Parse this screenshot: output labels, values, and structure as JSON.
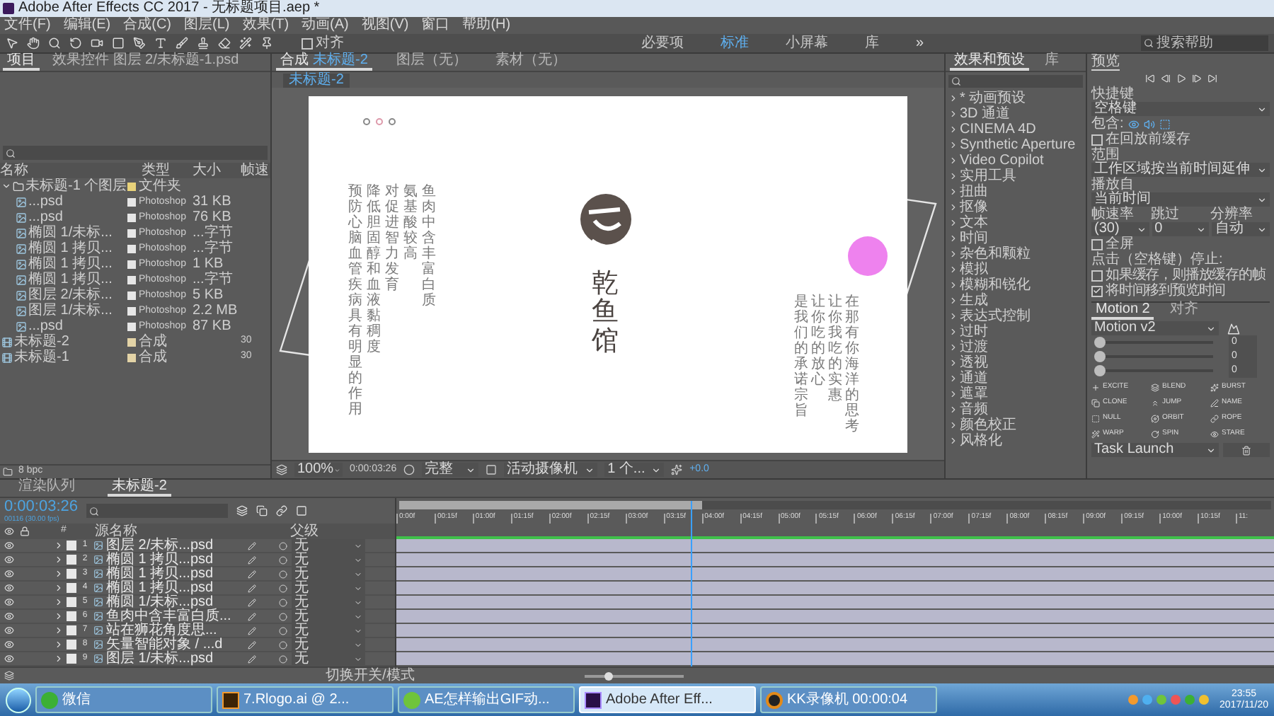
{
  "window": {
    "title": "Adobe After Effects CC 2017 - 无标题项目.aep *"
  },
  "menu": [
    "文件(F)",
    "编辑(E)",
    "合成(C)",
    "图层(L)",
    "效果(T)",
    "动画(A)",
    "视图(V)",
    "窗口",
    "帮助(H)"
  ],
  "toolbar": {
    "snap": {
      "label": "对齐",
      "checked": false
    },
    "workspaces": [
      {
        "label": "必要项",
        "selected": false
      },
      {
        "label": "标准",
        "selected": true
      },
      {
        "label": "小屏幕",
        "selected": false
      },
      {
        "label": "库",
        "selected": false
      }
    ],
    "overflow": "»",
    "search_placeholder": "搜索帮助"
  },
  "project": {
    "tabs": [
      {
        "label": "项目",
        "selected": true
      },
      {
        "label": "效果控件 图层 2/未标题-1.psd",
        "selected": false
      }
    ],
    "columns": [
      "名称",
      "类型",
      "大小",
      "帧速"
    ],
    "items": [
      {
        "kind": "folder",
        "name": "未标题-1 个图层",
        "type": "文件夹",
        "color": "#e8d27a",
        "expanded": true,
        "children": [
          {
            "kind": "psd",
            "name": "...psd",
            "type": "Photoshop",
            "size": "31 KB",
            "color": "#e6e6e6"
          },
          {
            "kind": "psd",
            "name": "...psd",
            "type": "Photoshop",
            "size": "76 KB",
            "color": "#e6e6e6"
          },
          {
            "kind": "psd",
            "name": "椭圆 1/未标...",
            "type": "Photoshop",
            "size": "...字节",
            "color": "#e6e6e6"
          },
          {
            "kind": "psd",
            "name": "椭圆 1 拷贝...",
            "type": "Photoshop",
            "size": "...字节",
            "color": "#e6e6e6"
          },
          {
            "kind": "psd",
            "name": "椭圆 1 拷贝...",
            "type": "Photoshop",
            "size": "1 KB",
            "color": "#e6e6e6"
          },
          {
            "kind": "psd",
            "name": "椭圆 1 拷贝...",
            "type": "Photoshop",
            "size": "...字节",
            "color": "#e6e6e6"
          },
          {
            "kind": "psd",
            "name": "图层 2/未标...",
            "type": "Photoshop",
            "size": "5 KB",
            "color": "#e6e6e6"
          },
          {
            "kind": "psd",
            "name": "图层 1/未标...",
            "type": "Photoshop",
            "size": "2.2 MB",
            "color": "#e6e6e6"
          },
          {
            "kind": "psd",
            "name": "...psd",
            "type": "Photoshop",
            "size": "87 KB",
            "color": "#e6e6e6"
          }
        ]
      },
      {
        "kind": "comp",
        "name": "未标题-2",
        "type": "合成",
        "fps": "30",
        "color": "#e3d3a6"
      },
      {
        "kind": "comp",
        "name": "未标题-1",
        "type": "合成",
        "fps": "30",
        "color": "#e3d3a6"
      }
    ],
    "footer": "8 bpc"
  },
  "viewer": {
    "tabs": [
      {
        "label": "合成",
        "name": "未标题-2",
        "selected": true
      },
      {
        "label": "图层（无）",
        "selected": false
      },
      {
        "label": "素材（无）",
        "selected": false
      }
    ],
    "breadcrumb": "未标题-2",
    "artboard": {
      "left_columns": [
        "预防心脑血管疾病具有明显的作用",
        "降低胆固醇和血液黏稠度",
        "对促进智力发育",
        "氨基酸较高",
        "鱼肉中含丰富白质"
      ],
      "logo_title": "乾鱼馆",
      "right_columns": [
        "是我们的承诺宗旨",
        "让你吃的放心",
        "让你我吃的实惠",
        "在那有你海洋的思考"
      ]
    },
    "controls": {
      "zoom": "100%",
      "time": "0:00:03:26",
      "resolution": "完整",
      "camera": "活动摄像机",
      "views": "1 个...",
      "exposure": "+0.0"
    }
  },
  "effects": {
    "tabs": [
      {
        "label": "效果和预设",
        "selected": true
      },
      {
        "label": "库",
        "selected": false
      }
    ],
    "items": [
      "* 动画预设",
      "3D 通道",
      "CINEMA 4D",
      "Synthetic Aperture",
      "Video Copilot",
      "实用工具",
      "扭曲",
      "抠像",
      "文本",
      "时间",
      "杂色和颗粒",
      "模拟",
      "模糊和锐化",
      "生成",
      "表达式控制",
      "过时",
      "过渡",
      "透视",
      "通道",
      "遮罩",
      "音频",
      "颜色校正",
      "风格化"
    ]
  },
  "preview": {
    "title": "预览",
    "shortcut_label": "快捷键",
    "shortcut": "空格键",
    "include_label": "包含:",
    "cache_before": {
      "label": "在回放前缓存",
      "checked": false
    },
    "range_label": "范围",
    "range": "工作区域按当前时间延伸",
    "play_from_label": "播放自",
    "play_from": "当前时间",
    "frame_rate_label": "帧速率",
    "skip_label": "跳过",
    "resolution_label": "分辨率",
    "frame_rate": "(30)",
    "skip": "0",
    "resolution": "自动",
    "fullscreen": {
      "label": "全屏",
      "checked": false
    },
    "stop_label": "点击（空格键）停止:",
    "stop_options": [
      {
        "label": "如果缓存，则播放缓存的帧",
        "checked": false
      },
      {
        "label": "将时间移到预览时间",
        "checked": true
      }
    ]
  },
  "motion": {
    "tabs": [
      {
        "label": "Motion 2",
        "selected": true
      },
      {
        "label": "对齐",
        "selected": false
      }
    ],
    "preset": "Motion v2",
    "sliders": [
      {
        "level": 0,
        "value": "0"
      },
      {
        "level": 0,
        "value": "0"
      },
      {
        "level": 0,
        "value": "0"
      }
    ],
    "buttons": [
      "EXCITE",
      "BLEND",
      "BURST",
      "CLONE",
      "JUMP",
      "NAME",
      "NULL",
      "ORBIT",
      "ROPE",
      "WARP",
      "SPIN",
      "STARE"
    ],
    "launcher": "Task Launch"
  },
  "timeline": {
    "tabs": [
      {
        "label": "渲染队列",
        "selected": false
      },
      {
        "label": "未标题-2",
        "selected": true
      }
    ],
    "time": "0:00:03:26",
    "frame_info": "00116 (30.00 fps)",
    "columns": {
      "number": "#",
      "name": "源名称",
      "parent": "父级"
    },
    "layers": [
      {
        "number": "1",
        "name": "图层 2/未标...psd",
        "parent": "无"
      },
      {
        "number": "2",
        "name": "椭圆 1 拷贝...psd",
        "parent": "无"
      },
      {
        "number": "3",
        "name": "椭圆 1 拷贝...psd",
        "parent": "无"
      },
      {
        "number": "4",
        "name": "椭圆 1 拷贝...psd",
        "parent": "无"
      },
      {
        "number": "5",
        "name": "椭圆 1/未标...psd",
        "parent": "无"
      },
      {
        "number": "6",
        "name": "鱼肉中含丰富白质...",
        "parent": "无"
      },
      {
        "number": "7",
        "name": "站在狮花角度思...",
        "parent": "无"
      },
      {
        "number": "8",
        "name": "矢量智能对象 / ...d",
        "parent": "无"
      },
      {
        "number": "9",
        "name": "图层 1/未标...psd",
        "parent": "无"
      }
    ],
    "ruler": [
      "0:00f",
      "00:15f",
      "01:00f",
      "01:15f",
      "02:00f",
      "02:15f",
      "03:00f",
      "03:15f",
      "04:00f",
      "04:15f",
      "05:00f",
      "05:15f",
      "06:00f",
      "06:15f",
      "07:00f",
      "07:15f",
      "08:00f",
      "08:15f",
      "09:00f",
      "09:15f",
      "10:00f",
      "10:15f",
      "11:"
    ],
    "work_area": {
      "level": 0.348
    },
    "zoom": {
      "level": 0.25
    },
    "playhead": {
      "level": 0.336
    },
    "footer": "切换开关/模式"
  },
  "taskbar": {
    "items": [
      {
        "kind": "chat",
        "label": "微信",
        "selected": false
      },
      {
        "kind": "ai",
        "label": "7.Rlogo.ai @ 2...",
        "selected": false
      },
      {
        "kind": "browser",
        "label": "AE怎样输出GIF动...",
        "selected": false
      },
      {
        "kind": "ae",
        "label": "Adobe After Eff...",
        "selected": true
      },
      {
        "kind": "recorder",
        "label": "KK录像机 00:00:04",
        "selected": false
      }
    ],
    "clock": {
      "time": "23:55",
      "date": "2017/11/20"
    }
  }
}
